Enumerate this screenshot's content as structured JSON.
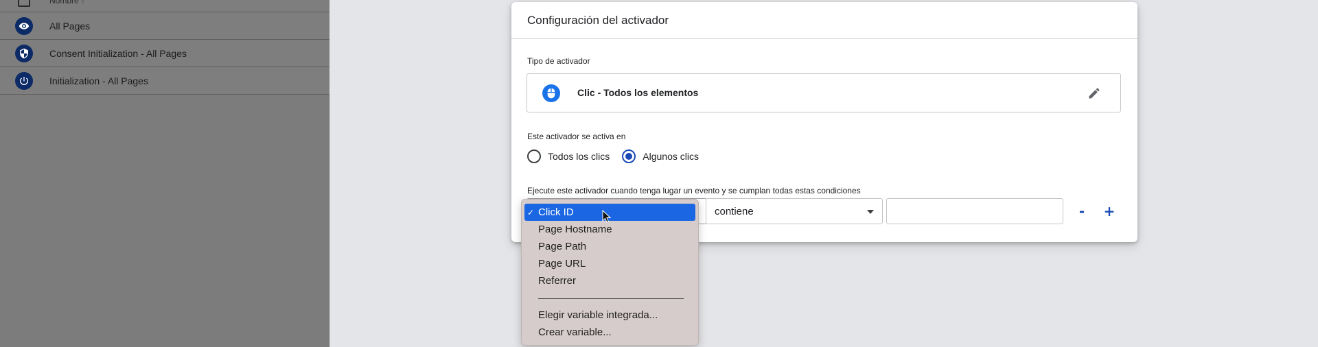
{
  "left_panel": {
    "partial_row_label": "Nombre ↑",
    "rows": [
      {
        "label": "All Pages",
        "icon": "eye-icon"
      },
      {
        "label": "Consent Initialization - All Pages",
        "icon": "shield-icon"
      },
      {
        "label": "Initialization - All Pages",
        "icon": "power-icon"
      }
    ]
  },
  "dialog": {
    "title": "Configuración del activador",
    "trigger_type_label": "Tipo de activador",
    "trigger_type_name": "Clic - Todos los elementos",
    "trigger_type_icon": "mouse-icon",
    "fires_on_label": "Este activador se activa en",
    "radio_options": [
      {
        "label": "Todos los clics",
        "checked": false
      },
      {
        "label": "Algunos clics",
        "checked": true
      }
    ],
    "conditions_label": "Ejecute este activador cuando tenga lugar un evento y se cumplan todas estas condiciones",
    "condition": {
      "operator": "contiene",
      "value": "",
      "remove_label": "-",
      "add_label": "+"
    }
  },
  "dropdown": {
    "selected_check": "✓",
    "items": [
      {
        "label": "Click ID",
        "selected": true
      },
      {
        "label": "Page Hostname",
        "selected": false
      },
      {
        "label": "Page Path",
        "selected": false
      },
      {
        "label": "Page URL",
        "selected": false
      },
      {
        "label": "Referrer",
        "selected": false
      }
    ],
    "footer_items": [
      {
        "label": "Elegir variable integrada..."
      },
      {
        "label": "Crear variable..."
      }
    ]
  },
  "colors": {
    "accent_blue": "#1a49b5",
    "trigger_icon_blue": "#1a73e8",
    "selection_blue": "#1b66e2",
    "left_icon_navy": "#0b2a66"
  }
}
